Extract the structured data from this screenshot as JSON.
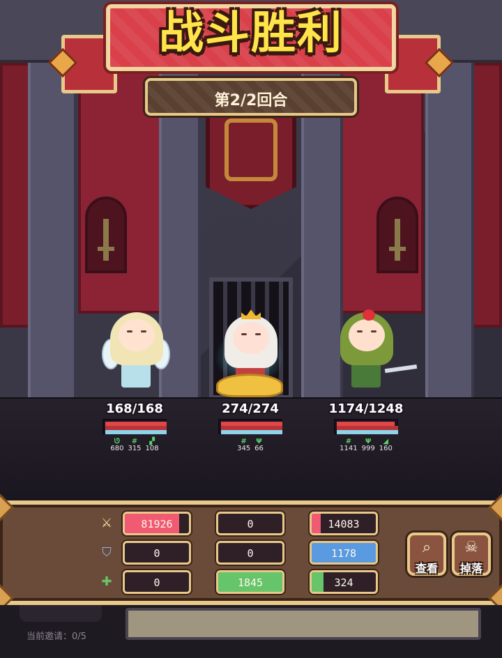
{
  "banner": {
    "title": "战斗胜利",
    "round": "第2/2回合"
  },
  "units": [
    {
      "name": "angel-girl",
      "hp_text": "168/168",
      "hp_fraction": 1.0,
      "attrs": [
        {
          "icon": "headset-icon",
          "value": "680"
        },
        {
          "icon": "hash-icon",
          "value": "315"
        },
        {
          "icon": "flag-icon",
          "value": "108"
        }
      ]
    },
    {
      "name": "priestess",
      "hp_text": "274/274",
      "hp_fraction": 1.0,
      "attrs": [
        {
          "icon": "hash-icon",
          "value": "345"
        },
        {
          "icon": "sprout-icon",
          "value": "66"
        }
      ]
    },
    {
      "name": "plant-girl",
      "hp_text": "1174/1248",
      "hp_fraction": 0.94,
      "attrs": [
        {
          "icon": "hash-icon",
          "value": "1141"
        },
        {
          "icon": "sprout-icon",
          "value": "999"
        },
        {
          "icon": "arrow-icon",
          "value": "160"
        }
      ]
    }
  ],
  "stats": {
    "rows": [
      {
        "icon": "sword-icon",
        "values": [
          "81926",
          "0",
          "14083"
        ],
        "fills": [
          0.85,
          0,
          0.14
        ],
        "colors": [
          "#f05a72",
          "#f05a72",
          "#f05a72"
        ]
      },
      {
        "icon": "shield-icon",
        "values": [
          "0",
          "0",
          "1178"
        ],
        "fills": [
          0,
          0,
          1.0
        ],
        "colors": [
          "#5a9ae0",
          "#5a9ae0",
          "#5a9ae0"
        ]
      },
      {
        "icon": "heal-icon",
        "values": [
          "0",
          "1845",
          "324"
        ],
        "fills": [
          0,
          1.0,
          0.18
        ],
        "colors": [
          "#66c46a",
          "#66c46a",
          "#66c46a"
        ]
      }
    ]
  },
  "buttons": {
    "view_label": "查看",
    "drop_label": "掉落"
  },
  "footer": {
    "invite": "当前邀请：0/5"
  },
  "colors": {
    "title_yellow": "#ffe44a",
    "banner_red": "#d9404a",
    "panel_brown": "#6a4a38",
    "gold_border": "#e8c98a"
  }
}
